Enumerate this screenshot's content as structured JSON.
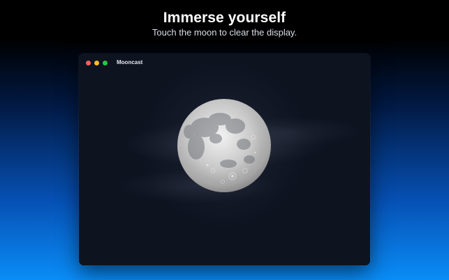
{
  "promo": {
    "headline": "Immerse yourself",
    "subhead": "Touch the moon to clear the display."
  },
  "window": {
    "title": "Mooncast",
    "traffic_lights": {
      "close_color": "#ff5f57",
      "minimize_color": "#febc2e",
      "zoom_color": "#28c840"
    }
  },
  "scene": {
    "background_color": "#0e1320",
    "moon_icon": "full-moon"
  }
}
